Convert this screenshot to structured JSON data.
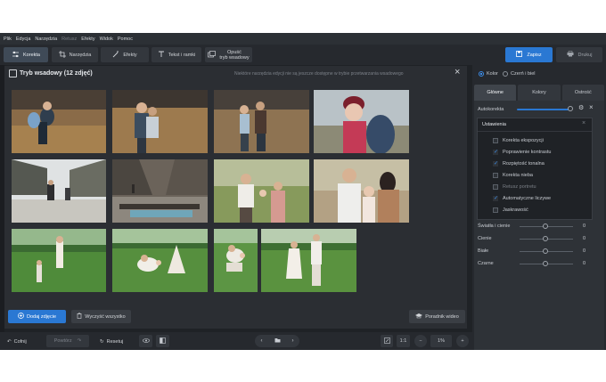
{
  "menu": [
    {
      "label": "Plik",
      "dim": false
    },
    {
      "label": "Edycja",
      "dim": false
    },
    {
      "label": "Narzędzia",
      "dim": false
    },
    {
      "label": "Retusz",
      "dim": true
    },
    {
      "label": "Efekty",
      "dim": false
    },
    {
      "label": "Widok",
      "dim": false
    },
    {
      "label": "Pomoc",
      "dim": false
    }
  ],
  "toolbar": {
    "tabs": [
      {
        "label": "Korekta",
        "icon": "sliders-icon"
      },
      {
        "label": "Narzędzia",
        "icon": "crop-icon"
      },
      {
        "label": "Efekty",
        "icon": "magic-wand-icon"
      },
      {
        "label": "Tekst i ramki",
        "icon": "text-icon"
      }
    ],
    "batch_label_1": "Opuść",
    "batch_label_2": "tryb wsadowy",
    "save": "Zapisz",
    "print": "Drukuj"
  },
  "batch": {
    "title": "Tryb wsadowy (12 zdjęć)",
    "notice": "Niektóre narzędzia edycji nie są jeszcze dostępne w trybie przetwarzania wsadowego",
    "add_photo": "Dodaj zdjęcie",
    "clear_all": "Wyczyść wszystko",
    "video_guide": "Poradnik wideo"
  },
  "photos": [
    {
      "scene": "field-couple"
    },
    {
      "scene": "field-couple"
    },
    {
      "scene": "field-couple"
    },
    {
      "scene": "child-closeup"
    },
    {
      "scene": "park-path"
    },
    {
      "scene": "bridge"
    },
    {
      "scene": "family-selfie"
    },
    {
      "scene": "family-selfie"
    },
    {
      "scene": "green-field"
    },
    {
      "scene": "green-field"
    },
    {
      "scene": "green-field"
    },
    {
      "scene": "green-field"
    }
  ],
  "bottombar": {
    "undo": "Cofnij",
    "redo": "Powtórz",
    "reset": "Resetuj",
    "zoom_ratio": "1:1",
    "zoom_percent": "1%"
  },
  "right_panel": {
    "mode_color": "Kolor",
    "mode_bw": "Czerń i biel",
    "tabs": [
      "Główne",
      "Kolory",
      "Ostrość"
    ],
    "autocorrect": "Autokorekta",
    "settings_title": "Ustawienia",
    "options": [
      {
        "label": "Korekta ekspozycji",
        "checked": false,
        "dim": false
      },
      {
        "label": "Poprawienie kontrastu",
        "checked": true,
        "dim": false
      },
      {
        "label": "Rozpiętość tonalna",
        "checked": true,
        "dim": false
      },
      {
        "label": "Korekta nieba",
        "checked": false,
        "dim": false
      },
      {
        "label": "Retusz portretu",
        "checked": false,
        "dim": true
      },
      {
        "label": "Automatyczne liczywe",
        "checked": true,
        "dim": false
      },
      {
        "label": "Jaskrawość",
        "checked": false,
        "dim": false
      }
    ],
    "sliders": [
      {
        "label": "Światła i cienie",
        "value": "0"
      },
      {
        "label": "Cienie",
        "value": "0"
      },
      {
        "label": "Białe",
        "value": "0"
      },
      {
        "label": "Czarne",
        "value": "0"
      }
    ]
  },
  "colors": {
    "accent": "#2a78d3",
    "panel": "#2b2e33",
    "background": "#1f2226"
  }
}
